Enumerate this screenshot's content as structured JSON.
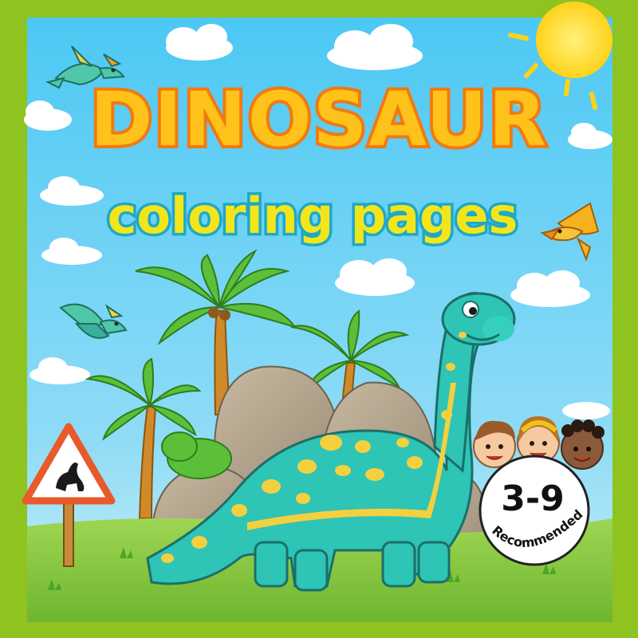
{
  "cover": {
    "title": "DINOSAUR",
    "subtitle": "coloring pages"
  },
  "age_badge": {
    "range": "3-9",
    "label": "Recommended"
  },
  "colors": {
    "frame": "#8fc31f",
    "sky": "#5ecff2",
    "title_fill": "#ffc21a",
    "title_outline": "#f07a12",
    "subtitle_fill": "#f2e61a",
    "subtitle_outline": "#1fa8c8",
    "dino_body": "#2ec4b6",
    "dino_spots": "#f4d03f",
    "grass": "#8bc34a",
    "sign_border": "#e85a2a"
  },
  "icons": {
    "pterodactyl": "pterodactyl-icon",
    "sun": "sun-icon",
    "warning_sign": "dinosaur-crossing-sign-icon",
    "kids": "kids-faces-icon"
  }
}
